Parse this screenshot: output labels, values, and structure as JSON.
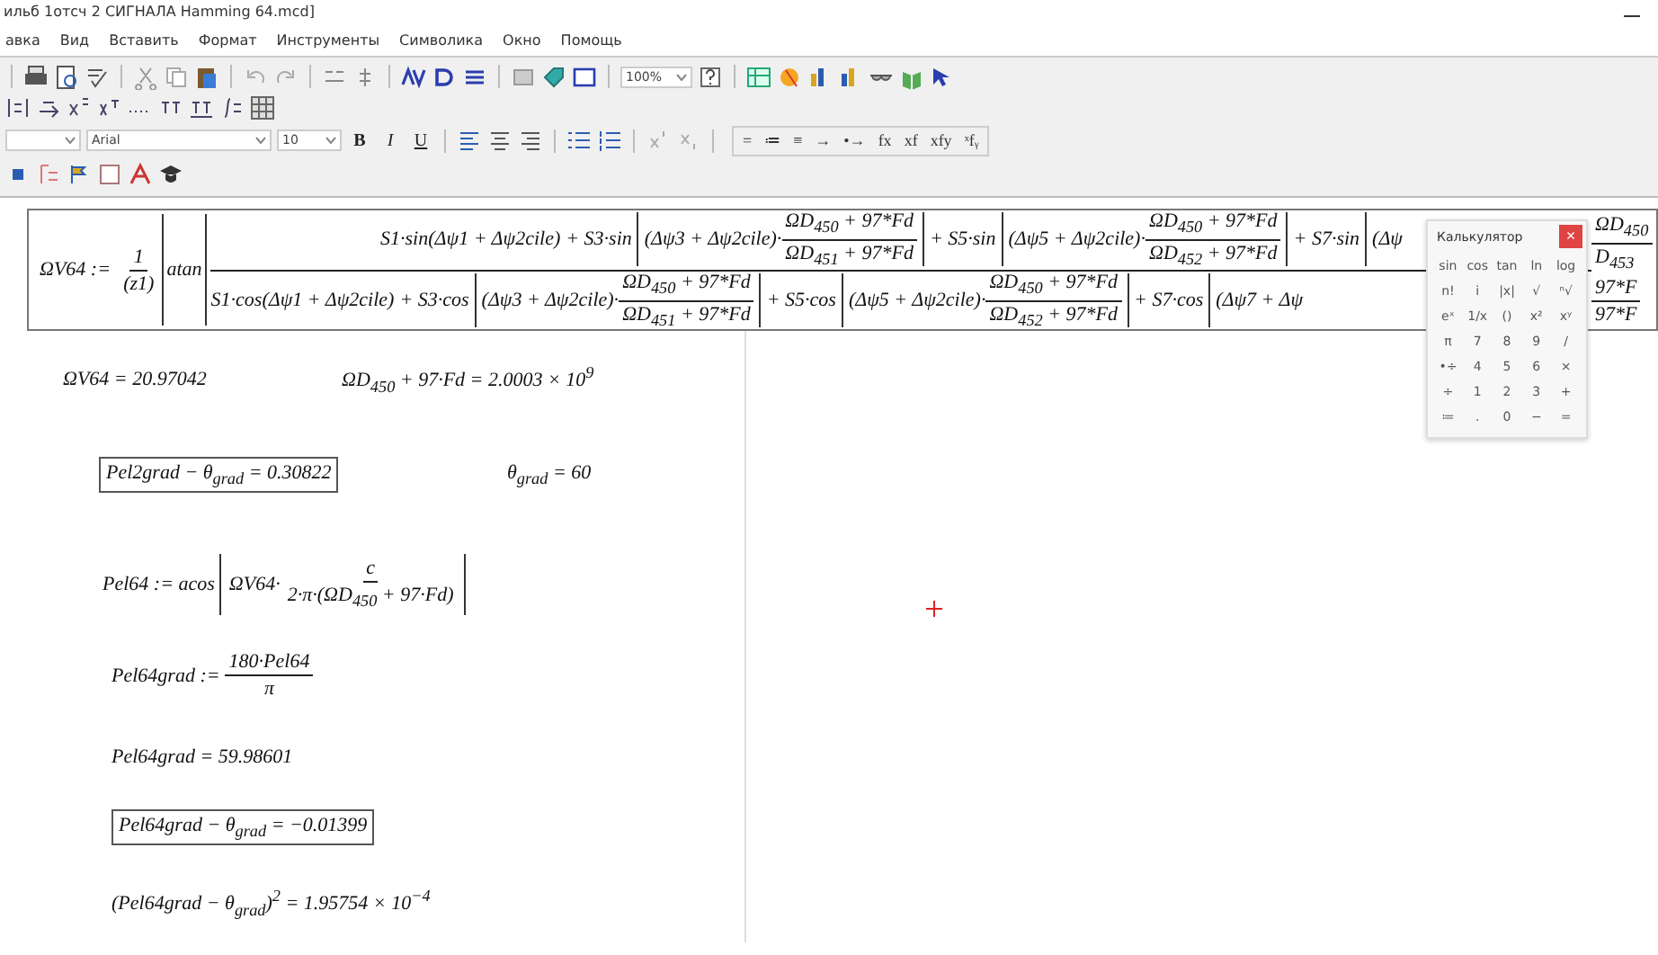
{
  "window": {
    "title": "ильб 1отсч 2 СИГНАЛА Hamming 64.mcd]"
  },
  "menu": [
    "авка",
    "Вид",
    "Вставить",
    "Формат",
    "Инструменты",
    "Символика",
    "Окно",
    "Помощь"
  ],
  "standard_toolbar": {
    "zoom": "100%"
  },
  "format_toolbar": {
    "font": "Arial",
    "size": "10",
    "styles": [
      "B",
      "I",
      "U"
    ]
  },
  "math_toolbar": [
    "=",
    "≔",
    "≡",
    "→",
    "•→",
    "fx",
    "xf",
    "xfy",
    "ˣfᵧ"
  ],
  "formula": {
    "lhs": "ΩV64 :=",
    "pre_num": "1",
    "pre_den": "(z1)",
    "func": "atan",
    "numerator": [
      {
        "kind": "plain",
        "text": "S1·sin(Δψ1 + Δψ2cile)"
      },
      {
        "kind": "bracket",
        "op": "+ S3·sin",
        "arg": "(Δψ3 + Δψ2cile)·",
        "num": "ΩD$_{450}$ + 97*Fd",
        "den": "ΩD$_{451}$ + 97*Fd"
      },
      {
        "kind": "bracket",
        "op": "+ S5·sin",
        "arg": "(Δψ5 + Δψ2cile)·",
        "num": "ΩD$_{450}$ + 97*Fd",
        "den": "ΩD$_{452}$ + 97*Fd"
      },
      {
        "kind": "cut",
        "op": "+ S7·sin",
        "arg": "(Δψ"
      }
    ],
    "denominator": [
      {
        "kind": "plain",
        "text": "S1·cos(Δψ1 + Δψ2cile)"
      },
      {
        "kind": "bracket",
        "op": "+ S3·cos",
        "arg": "(Δψ3 + Δψ2cile)·",
        "num": "ΩD$_{450}$ + 97*Fd",
        "den": "ΩD$_{451}$ + 97*Fd"
      },
      {
        "kind": "bracket",
        "op": "+ S5·cos",
        "arg": "(Δψ5 + Δψ2cile)·",
        "num": "ΩD$_{450}$ + 97*Fd",
        "den": "ΩD$_{452}$ + 97*Fd"
      },
      {
        "kind": "cut",
        "op": "+ S7·cos",
        "arg": "(Δψ7 + Δψ"
      }
    ],
    "numerator_tail": {
      "num": "ΩD$_{450}$",
      "den": "D$_{453}$"
    },
    "denominator_tail": {
      "num": "97*F",
      "den": "97*F"
    }
  },
  "regions": [
    {
      "kind": "pair",
      "left": "ΩV64 = 20.97042",
      "left_boxed": false,
      "right": "ΩD$_{450}$ + 97·Fd = 2.0003 × 10$^{9}$"
    },
    {
      "kind": "pair",
      "left": "Pel2grad − θ$_{grad}$ = 0.30822",
      "left_boxed": true,
      "right": "θ$_{grad}$ = 60"
    },
    {
      "kind": "acos",
      "lhs": "Pel64 := acos",
      "factor": "ΩV64·",
      "num": "c",
      "den": "2·π·(ΩD$_{450}$ + 97·Fd)"
    },
    {
      "kind": "fraction",
      "lhs": "Pel64grad :=",
      "num": "180·Pel64",
      "den": "π"
    },
    {
      "kind": "text",
      "text": "Pel64grad = 59.98601",
      "boxed": false
    },
    {
      "kind": "text",
      "text": "Pel64grad − θ$_{grad}$ = −0.01399",
      "boxed": true
    },
    {
      "kind": "text",
      "text": "(Pel64grad − θ$_{grad}$)$^{2}$ = 1.95754 × 10$^{−4}$",
      "boxed": false
    }
  ],
  "calculator": {
    "title": "Калькулятор",
    "close": "×",
    "keys": [
      "sin",
      "cos",
      "tan",
      "ln",
      "log",
      "n!",
      "i",
      "|x|",
      "√",
      "ⁿ√",
      "eˣ",
      "1/x",
      "()",
      "x²",
      "xʸ",
      "π",
      "7",
      "8",
      "9",
      "/",
      "•÷",
      "4",
      "5",
      "6",
      "×",
      "÷",
      "1",
      "2",
      "3",
      "+",
      "≔",
      ".",
      "0",
      "−",
      "="
    ]
  }
}
